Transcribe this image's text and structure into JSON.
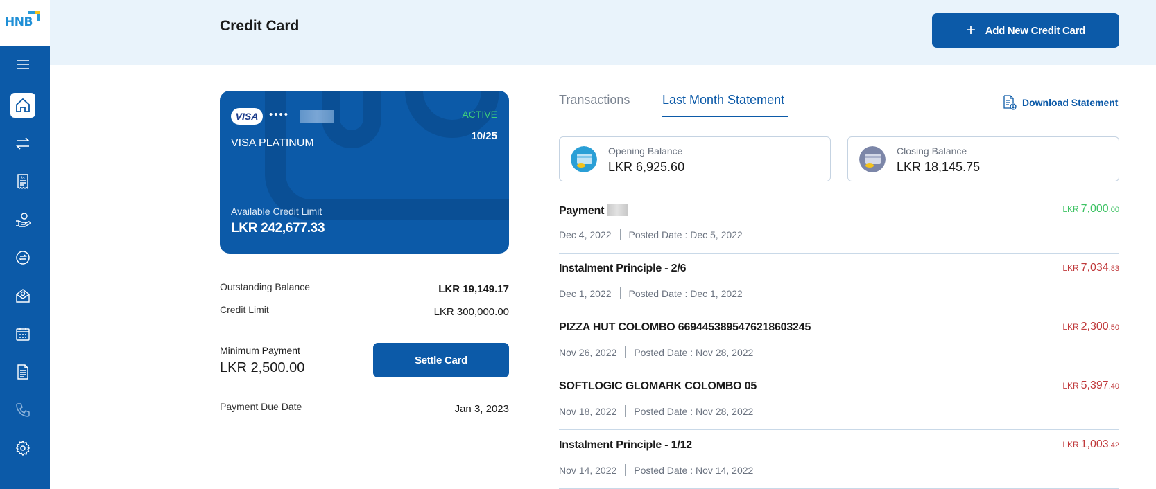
{
  "brand": {
    "logo_text": "HNB"
  },
  "header": {
    "title": "Credit Card",
    "add_button_label": "Add New Credit Card"
  },
  "sidebar": {
    "items": [
      {
        "name": "menu-icon"
      },
      {
        "name": "home-icon",
        "active": true
      },
      {
        "name": "transfer-icon"
      },
      {
        "name": "bill-icon"
      },
      {
        "name": "payment-hand-icon"
      },
      {
        "name": "exchange-icon"
      },
      {
        "name": "mail-icon"
      },
      {
        "name": "calendar-icon"
      },
      {
        "name": "document-icon"
      },
      {
        "name": "phone-icon"
      },
      {
        "name": "settings-icon"
      }
    ]
  },
  "card": {
    "network": "VISA",
    "masked_number": "••••",
    "status": "ACTIVE",
    "name": "VISA PLATINUM",
    "expiry": "10/25",
    "available_label": "Available Credit Limit",
    "available_value": "LKR 242,677.33"
  },
  "details": {
    "outstanding_label": "Outstanding Balance",
    "outstanding_value": "LKR 19,149.17",
    "credit_limit_label": "Credit Limit",
    "credit_limit_value": "LKR 300,000.00",
    "minimum_label": "Minimum Payment",
    "minimum_value": "LKR 2,500.00",
    "settle_button": "Settle Card",
    "due_label": "Payment Due Date",
    "due_value": "Jan 3, 2023"
  },
  "tabs": {
    "transactions": "Transactions",
    "last_month": "Last Month Statement",
    "download": "Download Statement"
  },
  "balances": {
    "opening_label": "Opening Balance",
    "opening_value": "LKR 6,925.60",
    "closing_label": "Closing Balance",
    "closing_value": "LKR 18,145.75"
  },
  "transactions": [
    {
      "title": "Payment",
      "date": "Dec 4, 2022",
      "posted": "Posted Date : Dec 5, 2022",
      "currency": "LKR",
      "amount": "7,000",
      "decimals": ".00",
      "type": "credit"
    },
    {
      "title": "Instalment Principle - 2/6",
      "date": "Dec 1, 2022",
      "posted": "Posted Date : Dec 1, 2022",
      "currency": "LKR",
      "amount": "7,034",
      "decimals": ".83",
      "type": "debit"
    },
    {
      "title": "PIZZA HUT COLOMBO 6694453895476218603245",
      "date": "Nov 26, 2022",
      "posted": "Posted Date : Nov 28, 2022",
      "currency": "LKR",
      "amount": "2,300",
      "decimals": ".50",
      "type": "debit"
    },
    {
      "title": "SOFTLOGIC GLOMARK COLOMBO 05",
      "date": "Nov 18, 2022",
      "posted": "Posted Date : Nov 28, 2022",
      "currency": "LKR",
      "amount": "5,397",
      "decimals": ".40",
      "type": "debit"
    },
    {
      "title": "Instalment Principle - 1/12",
      "date": "Nov 14, 2022",
      "posted": "Posted Date : Nov 14, 2022",
      "currency": "LKR",
      "amount": "1,003",
      "decimals": ".42",
      "type": "debit"
    }
  ],
  "colors": {
    "primary": "#0c5aa8",
    "credit": "#3ec364",
    "debit": "#c0393b",
    "active": "#3fd07a"
  }
}
